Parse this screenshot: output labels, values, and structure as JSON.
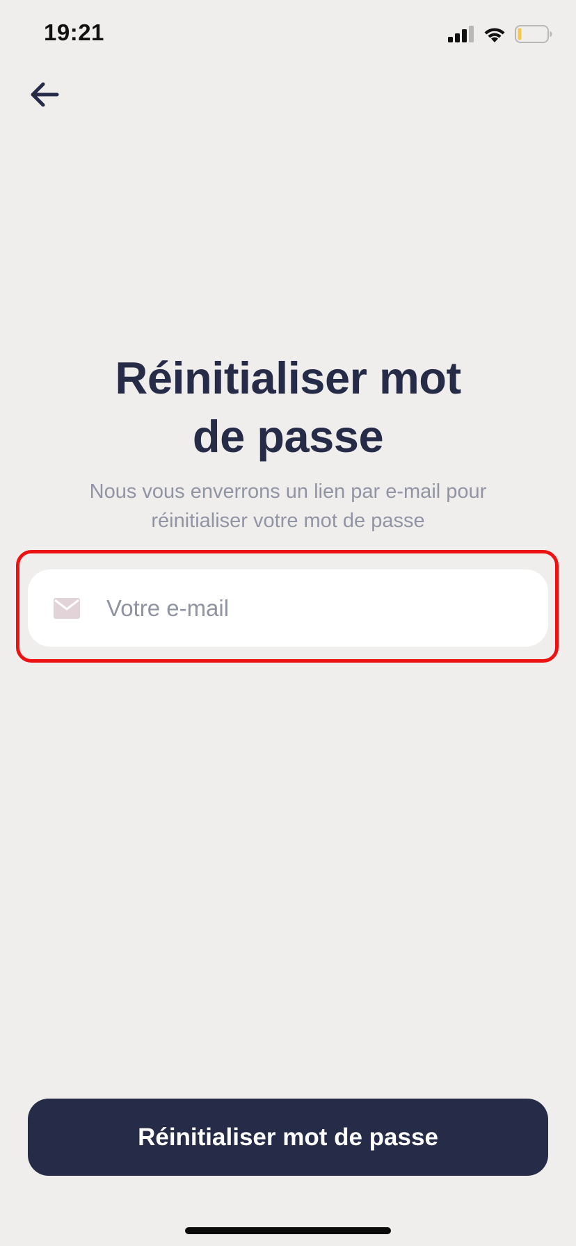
{
  "status_bar": {
    "time": "19:21",
    "icons": [
      "signal-icon",
      "wifi-icon",
      "battery-icon"
    ]
  },
  "nav": {
    "back_icon": "arrow-left-icon"
  },
  "page": {
    "title_line1": "Réinitialiser mot",
    "title_line2": "de passe",
    "subtitle_line1": "Nous vous enverrons un lien par e-mail pour",
    "subtitle_line2": "réinitialiser votre mot de passe"
  },
  "email_field": {
    "icon": "mail-icon",
    "placeholder": "Votre e-mail",
    "value": ""
  },
  "submit_button": {
    "label": "Réinitialiser mot de passe"
  },
  "colors": {
    "background": "#f0eeed",
    "primary": "#262b47",
    "subtitle": "#9195a3",
    "highlight": "#ee1111",
    "battery_low": "#f2c94c",
    "mail_icon": "#e2d3d8"
  }
}
